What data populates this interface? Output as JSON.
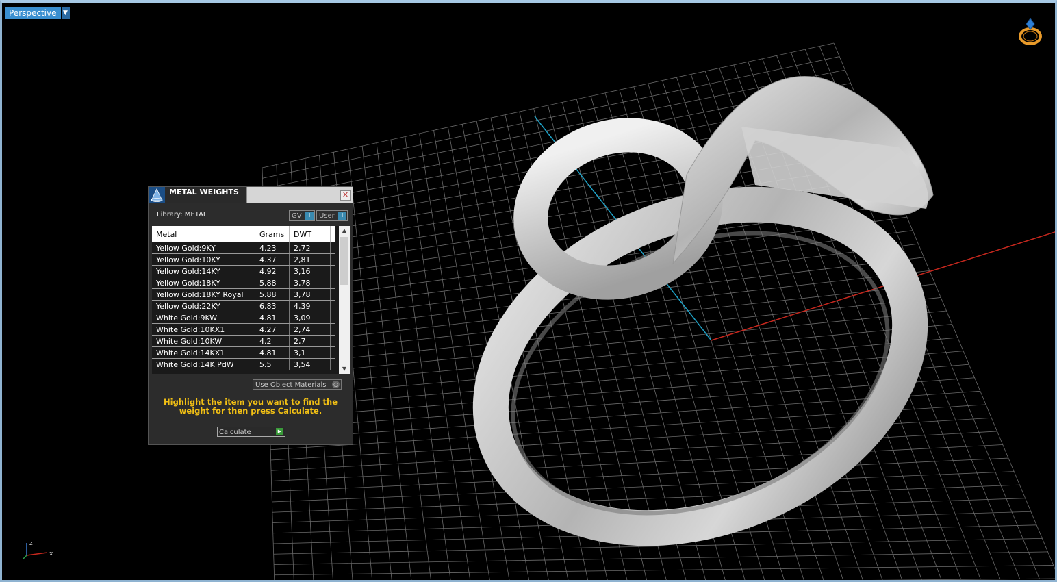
{
  "viewport": {
    "view_name": "Perspective"
  },
  "panel": {
    "title": "METAL WEIGHTS",
    "library_label": "Library: METAL",
    "buttons": {
      "gv": "GV",
      "user": "User",
      "indicator": "I"
    },
    "columns": [
      "Metal",
      "Grams",
      "DWT"
    ],
    "rows": [
      [
        "Yellow Gold:9KY",
        "4.23",
        "2,72"
      ],
      [
        "Yellow Gold:10KY",
        "4.37",
        "2,81"
      ],
      [
        "Yellow Gold:14KY",
        "4.92",
        "3,16"
      ],
      [
        "Yellow Gold:18KY",
        "5.88",
        "3,78"
      ],
      [
        "Yellow Gold:18KY Royal",
        "5.88",
        "3,78"
      ],
      [
        "Yellow Gold:22KY",
        "6.83",
        "4,39"
      ],
      [
        "White Gold:9KW",
        "4.81",
        "3,09"
      ],
      [
        "White Gold:10KX1",
        "4.27",
        "2,74"
      ],
      [
        "White Gold:10KW",
        "4.2",
        "2,7"
      ],
      [
        "White Gold:14KX1",
        "4.81",
        "3,1"
      ],
      [
        "White Gold:14K PdW",
        "5.5",
        "3,54"
      ]
    ],
    "use_object_materials": "Use Object Materials",
    "hint": "Highlight the item you want to find the weight for then press Calculate.",
    "calculate_label": "Calculate"
  },
  "axis": {
    "z": "z",
    "x": "x"
  },
  "colors": {
    "accent": "#3a8fd0",
    "hint": "#f2c014",
    "grid": "#6a6a6a"
  }
}
